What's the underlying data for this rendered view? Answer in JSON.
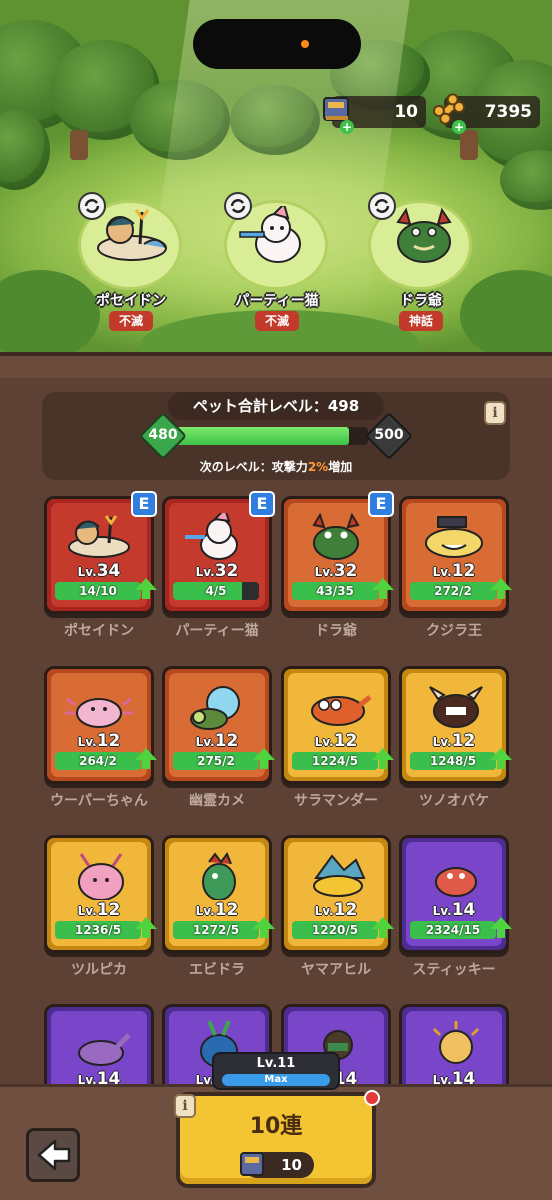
{
  "resources": {
    "tickets": "10",
    "bones": "7395"
  },
  "featured": [
    {
      "name": "ポセイドン",
      "tag": "不滅"
    },
    {
      "name": "パーティー猫",
      "tag": "不滅"
    },
    {
      "name": "ドラ爺",
      "tag": "神話"
    }
  ],
  "summary": {
    "title": "ペット合計レベル：498",
    "level_current": "480",
    "level_next": "500",
    "progress": 0.9,
    "next_bonus_prefix": "次のレベル：攻撃力",
    "next_bonus_value": "2%",
    "next_bonus_suffix": "増加",
    "info_label": "i"
  },
  "pets": [
    {
      "name": "ポセイドン",
      "lv_prefix": "Lv.",
      "level": "34",
      "count": "14/10",
      "progress": 1.0,
      "rarity": "red",
      "equipped": true,
      "badge": "E"
    },
    {
      "name": "パーティー猫",
      "lv_prefix": "Lv.",
      "level": "32",
      "count": "4/5",
      "progress": 0.8,
      "rarity": "red",
      "equipped": true,
      "badge": "E"
    },
    {
      "name": "ドラ爺",
      "lv_prefix": "Lv.",
      "level": "32",
      "count": "43/35",
      "progress": 1.0,
      "rarity": "orange",
      "equipped": true,
      "badge": "E"
    },
    {
      "name": "クジラ王",
      "lv_prefix": "Lv.",
      "level": "12",
      "count": "272/2",
      "progress": 1.0,
      "rarity": "orange",
      "equipped": false
    },
    {
      "name": "ウーパーちゃん",
      "lv_prefix": "Lv.",
      "level": "12",
      "count": "264/2",
      "progress": 1.0,
      "rarity": "orange",
      "equipped": false
    },
    {
      "name": "幽霊カメ",
      "lv_prefix": "Lv.",
      "level": "12",
      "count": "275/2",
      "progress": 1.0,
      "rarity": "orange",
      "equipped": false
    },
    {
      "name": "サラマンダー",
      "lv_prefix": "Lv.",
      "level": "12",
      "count": "1224/5",
      "progress": 1.0,
      "rarity": "yellow",
      "equipped": false
    },
    {
      "name": "ツノオバケ",
      "lv_prefix": "Lv.",
      "level": "12",
      "count": "1248/5",
      "progress": 1.0,
      "rarity": "yellow",
      "equipped": false
    },
    {
      "name": "ツルピカ",
      "lv_prefix": "Lv.",
      "level": "12",
      "count": "1236/5",
      "progress": 1.0,
      "rarity": "yellow",
      "equipped": false
    },
    {
      "name": "エビドラ",
      "lv_prefix": "Lv.",
      "level": "12",
      "count": "1272/5",
      "progress": 1.0,
      "rarity": "yellow",
      "equipped": false
    },
    {
      "name": "ヤマアヒル",
      "lv_prefix": "Lv.",
      "level": "12",
      "count": "1220/5",
      "progress": 1.0,
      "rarity": "yellow",
      "equipped": false
    },
    {
      "name": "スティッキー",
      "lv_prefix": "Lv.",
      "level": "14",
      "count": "2324/15",
      "progress": 1.0,
      "rarity": "purple",
      "equipped": false
    },
    {
      "name": "",
      "lv_prefix": "Lv.",
      "level": "14",
      "count": "",
      "progress": 0,
      "rarity": "purple",
      "equipped": false
    },
    {
      "name": "",
      "lv_prefix": "Lv.",
      "level": "14",
      "count": "",
      "progress": 0,
      "rarity": "purple",
      "equipped": false
    },
    {
      "name": "",
      "lv_prefix": "Lv.",
      "level": "14",
      "count": "",
      "progress": 0,
      "rarity": "purple",
      "equipped": false
    },
    {
      "name": "",
      "lv_prefix": "Lv.",
      "level": "14",
      "count": "",
      "progress": 0,
      "rarity": "purple",
      "equipped": false
    }
  ],
  "bottom": {
    "pull_label": "10連",
    "pull_cost": "10",
    "gacha_level": "Lv.11",
    "gacha_level_status": "Max",
    "info_label": "i"
  },
  "colors": {
    "progress_green": "#3bbf4c",
    "equip_badge_blue": "#2f7ee0",
    "tag_red": "#c23b2a",
    "highlight_orange": "#ff9a36"
  }
}
